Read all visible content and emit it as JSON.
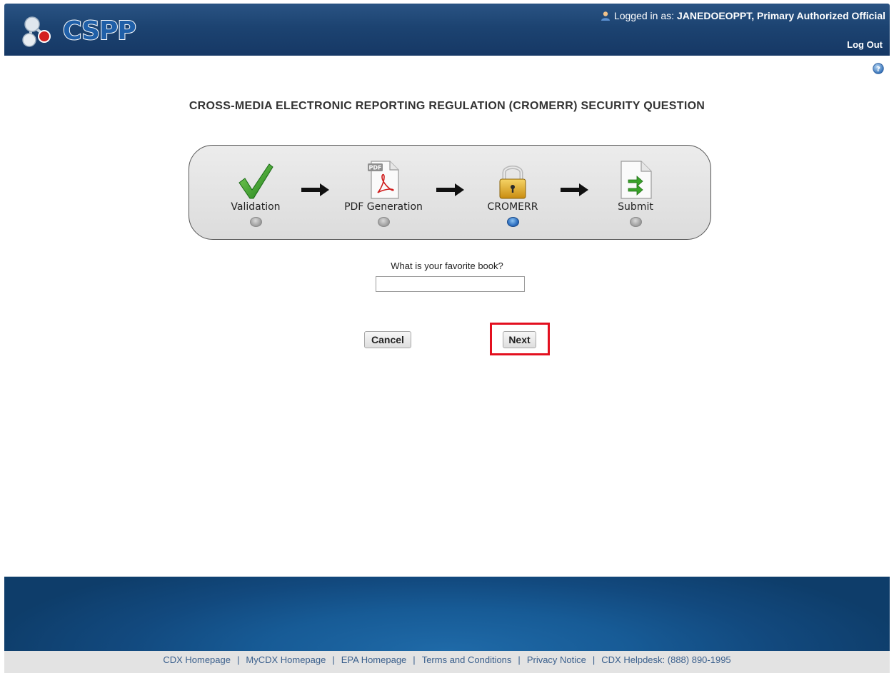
{
  "header": {
    "logo_text": "CSPP",
    "logged_in_prefix": "Logged in as:",
    "user": "JANEDOEOPPT, Primary Authorized Official",
    "logout_label": "Log Out"
  },
  "page": {
    "title": "CROSS-MEDIA ELECTRONIC REPORTING REGULATION (CROMERR) SECURITY QUESTION"
  },
  "stepper": {
    "steps": [
      {
        "label": "Validation",
        "icon": "checkmark-icon",
        "active": false
      },
      {
        "label": "PDF Generation",
        "icon": "pdf-document-icon",
        "active": false
      },
      {
        "label": "CROMERR",
        "icon": "padlock-icon",
        "active": true
      },
      {
        "label": "Submit",
        "icon": "submit-document-icon",
        "active": false
      }
    ],
    "pdf_badge": "PDF"
  },
  "form": {
    "question": "What is your favorite book?",
    "answer_value": "",
    "cancel_label": "Cancel",
    "next_label": "Next"
  },
  "footer": {
    "links": [
      "CDX Homepage",
      "MyCDX Homepage",
      "EPA Homepage",
      "Terms and Conditions",
      "Privacy Notice",
      "CDX Helpdesk: (888) 890-1995"
    ],
    "separator": "|"
  },
  "colors": {
    "header_blue": "#1c4371",
    "highlight_red": "#e3101f",
    "active_step": "#2e6fc0",
    "link_blue": "#3a5f8c"
  }
}
